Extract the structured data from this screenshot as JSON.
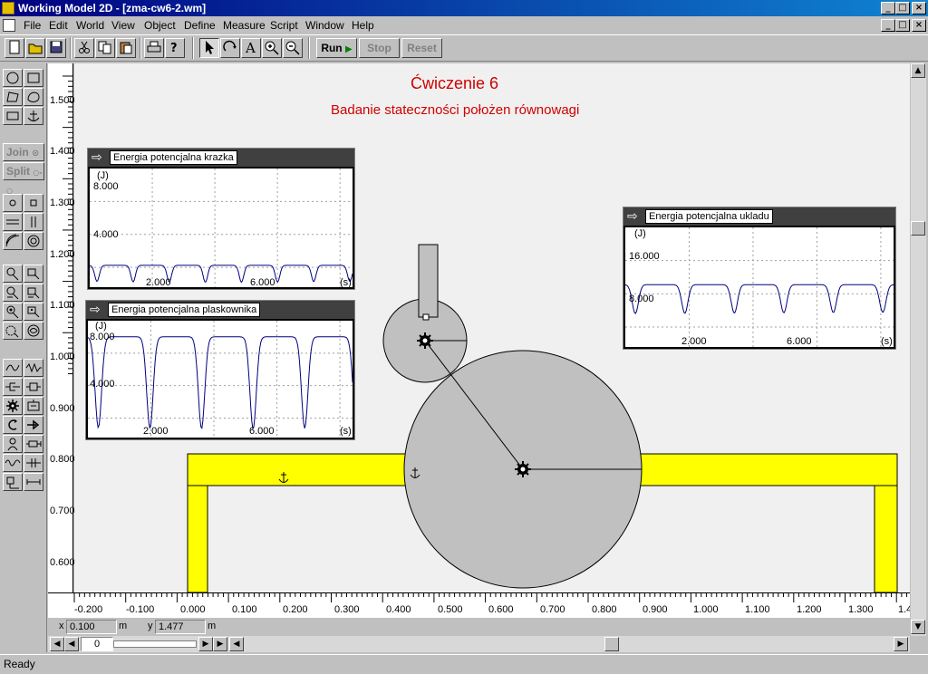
{
  "window": {
    "title": "Working Model 2D - [zma-cw6-2.wm]"
  },
  "window_controls": {
    "min": "_",
    "max": "□",
    "close": "×"
  },
  "menu": [
    "File",
    "Edit",
    "World",
    "View",
    "Object",
    "Define",
    "Measure",
    "Script",
    "Window",
    "Help"
  ],
  "toolbar": {
    "run_label": "Run",
    "stop_label": "Stop",
    "reset_label": "Reset",
    "icons": [
      "new-icon",
      "open-icon",
      "save-icon",
      "cut-icon",
      "copy-icon",
      "paste-icon",
      "print-icon",
      "help-icon",
      "pointer-icon",
      "rotate-icon",
      "text-icon",
      "zoom-in-icon",
      "zoom-out-icon"
    ]
  },
  "palette": {
    "join_label": "Join",
    "split_label": "Split"
  },
  "canvas": {
    "title": "Ćwiczenie 6",
    "subtitle": "Badanie stateczności położen równowagi",
    "colors": {
      "title": "#d00000",
      "beam": "#ffff00",
      "body": "#c0c0c0",
      "curve": "#000080",
      "background": "#f0f0f0"
    }
  },
  "meters": [
    {
      "id": "krazka",
      "title": "Energia potencjalna krazka",
      "unit_y": "(J)",
      "unit_x": "(s)",
      "y_ticks": [
        "8.000",
        "4.000"
      ],
      "x_ticks": [
        "2.000",
        "6.000"
      ],
      "series": {
        "period": 1.1,
        "base": 2.1,
        "dip": 1.2,
        "xmax": 8.0,
        "ymin": 0.5,
        "ymax": 9.2
      }
    },
    {
      "id": "plaskownika",
      "title": "Energia potencjalna plaskownika",
      "unit_y": "(J)",
      "unit_x": "(s)",
      "y_ticks": [
        "8.000",
        "4.000"
      ],
      "x_ticks": [
        "2.000",
        "6.000"
      ],
      "series": {
        "period": 1.6,
        "base": 8.3,
        "dip": 6.6,
        "xmax": 8.2,
        "ymin": 0.8,
        "ymax": 9.5
      }
    },
    {
      "id": "ukladu",
      "title": "Energia potencjalna ukladu",
      "unit_y": "(J)",
      "unit_x": "(s)",
      "y_ticks": [
        "16.000",
        "8.000"
      ],
      "x_ticks": [
        "2.000",
        "6.000"
      ],
      "series": {
        "period": 1.55,
        "base": 10.4,
        "dip": 4.5,
        "xmax": 8.4,
        "ymin": 0.5,
        "ymax": 19.5
      }
    }
  ],
  "rulers": {
    "y": [
      "1.500",
      "1.400",
      "1.300",
      "1.200",
      "1.100",
      "1.000",
      "0.900",
      "0.800",
      "0.700",
      "0.600"
    ],
    "x": [
      "-0.200",
      "-0.100",
      "0.000",
      "0.100",
      "0.200",
      "0.300",
      "0.400",
      "0.500",
      "0.600",
      "0.700",
      "0.800",
      "0.900",
      "1.000",
      "1.100",
      "1.200",
      "1.300",
      "1.4"
    ]
  },
  "coords": {
    "x_label": "x",
    "x_value": "0.100",
    "x_unit": "m",
    "y_label": "y",
    "y_value": "1.477",
    "y_unit": "m"
  },
  "tape": {
    "frame": "0"
  },
  "status": "Ready"
}
